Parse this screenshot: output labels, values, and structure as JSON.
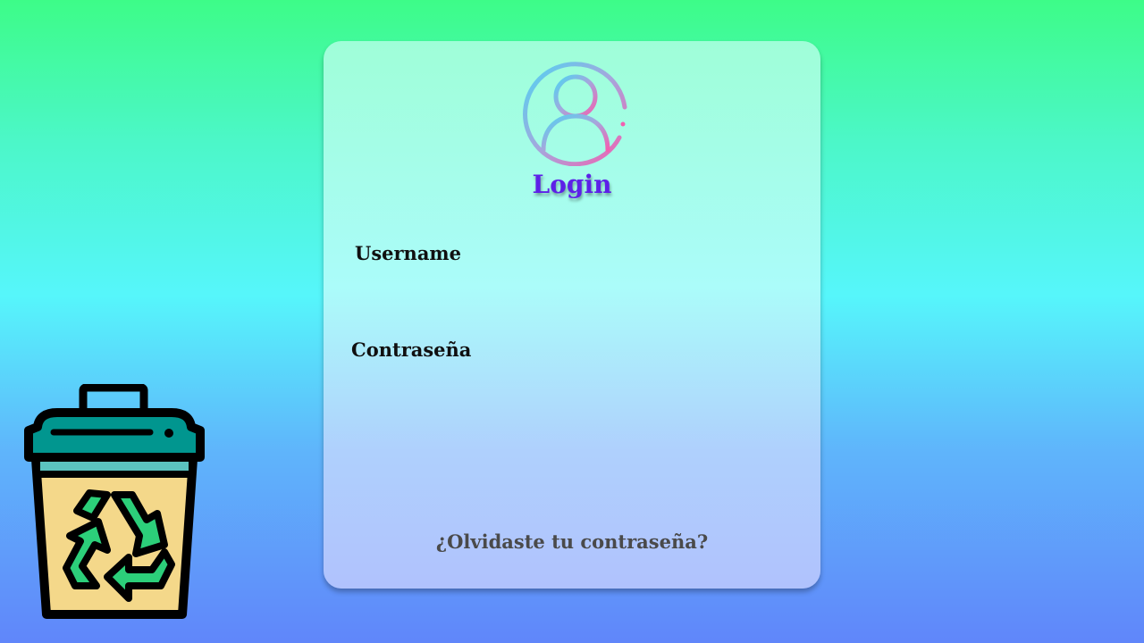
{
  "login": {
    "title": "Login",
    "username_label": "Username",
    "password_label": "Contraseña",
    "username_value": "",
    "password_value": "",
    "forgot_link": "¿Olvidaste tu contraseña?"
  },
  "icons": {
    "avatar": "user-circle-icon",
    "recycle_bin": "recycle-bin-icon"
  },
  "colors": {
    "background_top": "#3dfc88",
    "background_middle": "#56f6fb",
    "background_bottom": "#6086fa",
    "title": "#5d20e8",
    "forgot_link": "#4a4a4a",
    "bin_teal": "#01968f",
    "bin_body": "#f4d88a",
    "recycle_green": "#2ccf7a"
  }
}
